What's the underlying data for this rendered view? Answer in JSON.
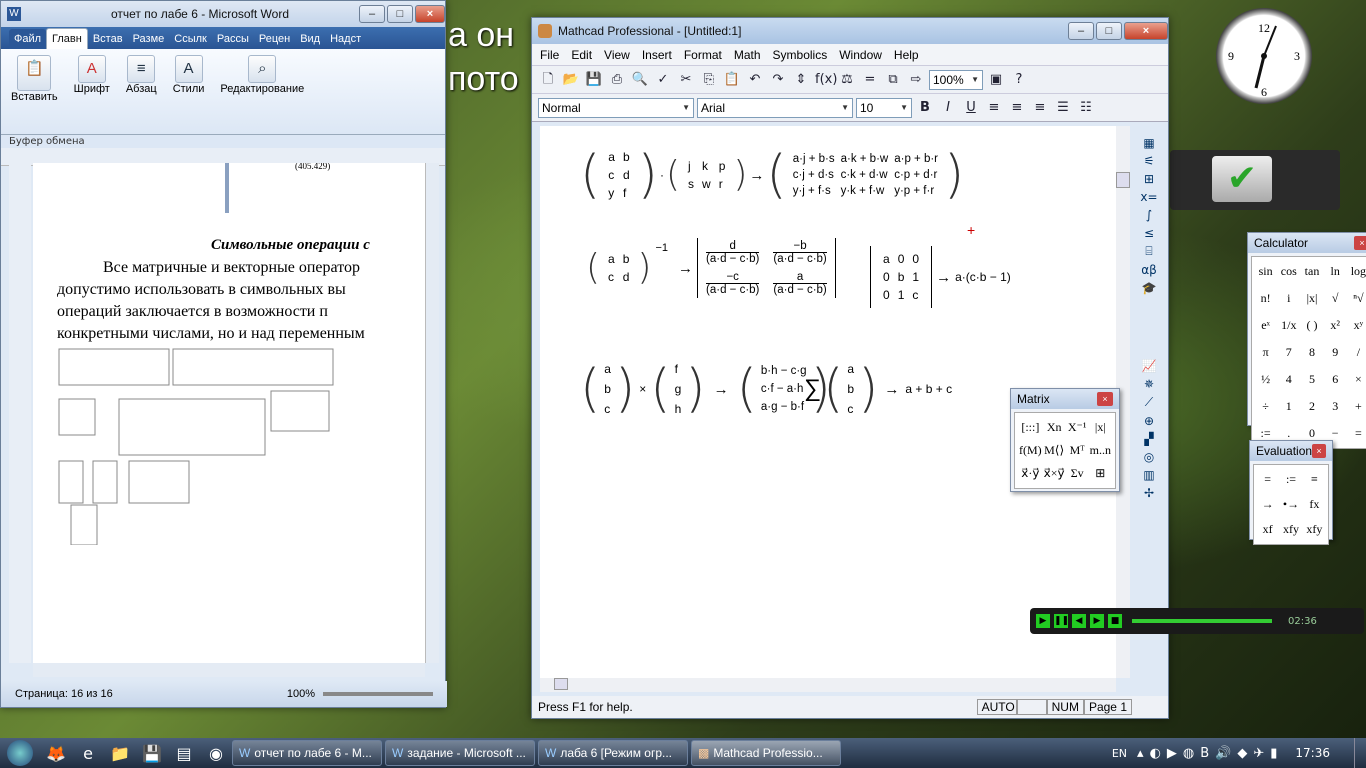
{
  "desktop": {
    "bg_text_line1": "а он",
    "bg_text_line2": "пото"
  },
  "word": {
    "title": "отчет по лабе 6 - Microsoft Word",
    "tabs": [
      "Файл",
      "Главн",
      "Встав",
      "Разме",
      "Ссылк",
      "Рассы",
      "Рецен",
      "Вид",
      "Надст"
    ],
    "groups": {
      "paste": "Вставить",
      "font": "Шрифт",
      "paragraph": "Абзац",
      "styles": "Стили",
      "editing": "Редактирование",
      "clipboard": "Буфер обмена"
    },
    "doc": {
      "small_number": "(405.429)",
      "heading": "Символьные операции с",
      "para1": "Все матричные и векторные оператор",
      "para2": "допустимо использовать в символьных вы",
      "para3": "операций заключается в возможности п",
      "para4": "конкретными числами, но и над переменным"
    },
    "status": {
      "page": "Страница: 16 из 16",
      "zoom": "100%"
    }
  },
  "mathcad": {
    "title": "Mathcad Professional - [Untitled:1]",
    "menu": [
      "File",
      "Edit",
      "View",
      "Insert",
      "Format",
      "Math",
      "Symbolics",
      "Window",
      "Help"
    ],
    "zoom": "100%",
    "style": "Normal",
    "font": "Arial",
    "size": "10",
    "eq1": {
      "m1": [
        [
          "a",
          "b"
        ],
        [
          "c",
          "d"
        ],
        [
          "y",
          "f"
        ]
      ],
      "m2": [
        [
          "j",
          "k",
          "p"
        ],
        [
          "s",
          "w",
          "r"
        ]
      ],
      "res": [
        [
          "a·j + b·s",
          "a·k + b·w",
          "a·p + b·r"
        ],
        [
          "c·j + d·s",
          "c·k + d·w",
          "c·p + d·r"
        ],
        [
          "y·j + f·s",
          "y·k + f·w",
          "y·p + f·r"
        ]
      ]
    },
    "eq2": {
      "m": [
        [
          "a",
          "b"
        ],
        [
          "c",
          "d"
        ]
      ],
      "exp": "−1",
      "r11n": "d",
      "r11d": "(a·d − c·b)",
      "r12n": "−b",
      "r12d": "(a·d − c·b)",
      "r21n": "−c",
      "r21d": "(a·d − c·b)",
      "r22n": "a",
      "r22d": "(a·d − c·b)"
    },
    "eq3": {
      "m": [
        [
          "a",
          "0",
          "0"
        ],
        [
          "0",
          "b",
          "1"
        ],
        [
          "0",
          "1",
          "c"
        ]
      ],
      "res": "a·(c·b − 1)"
    },
    "eq4": {
      "v1": [
        "a",
        "b",
        "c"
      ],
      "v2": [
        "f",
        "g",
        "h"
      ],
      "res": [
        "b·h − c·g",
        "c·f − a·h",
        "a·g − b·f"
      ]
    },
    "eq5": {
      "v": [
        "a",
        "b",
        "c"
      ],
      "res": "a + b + c"
    },
    "arrow": "→",
    "cross": "×",
    "sum": "∑",
    "status": {
      "help": "Press F1 for help.",
      "auto": "AUTO",
      "num": "NUM",
      "page": "Page 1"
    }
  },
  "matrix_palette": {
    "title": "Matrix",
    "buttons": [
      "[:::]",
      "Xn",
      "X⁻¹",
      "|x|",
      "f(M)",
      "M⟨⟩",
      "Mᵀ",
      "m..n",
      "x⃗·y⃗",
      "x⃗×y⃗",
      "Σv",
      "⊞"
    ]
  },
  "calculator": {
    "title": "Calculator",
    "keys": [
      "sin",
      "cos",
      "tan",
      "ln",
      "log",
      "n!",
      "i",
      "|x|",
      "√",
      "ⁿ√",
      "eˣ",
      "1/x",
      "( )",
      "x²",
      "xʸ",
      "π",
      "7",
      "8",
      "9",
      "/",
      "½",
      "4",
      "5",
      "6",
      "×",
      "÷",
      "1",
      "2",
      "3",
      "+",
      ":=",
      ".",
      "0",
      "−",
      "="
    ]
  },
  "evaluation": {
    "title": "Evaluation",
    "keys": [
      "=",
      ":=",
      "≡",
      "→",
      "•→",
      "fx",
      "xf",
      "xfy",
      "xfy"
    ]
  },
  "media": {
    "time": "02:36"
  },
  "taskbar": {
    "items": [
      "отчет по лабе 6 - M...",
      "задание - Microsoft ...",
      "лаба 6 [Режим огр...",
      "Mathcad Professio..."
    ],
    "lang": "EN",
    "clock": "17:36"
  }
}
